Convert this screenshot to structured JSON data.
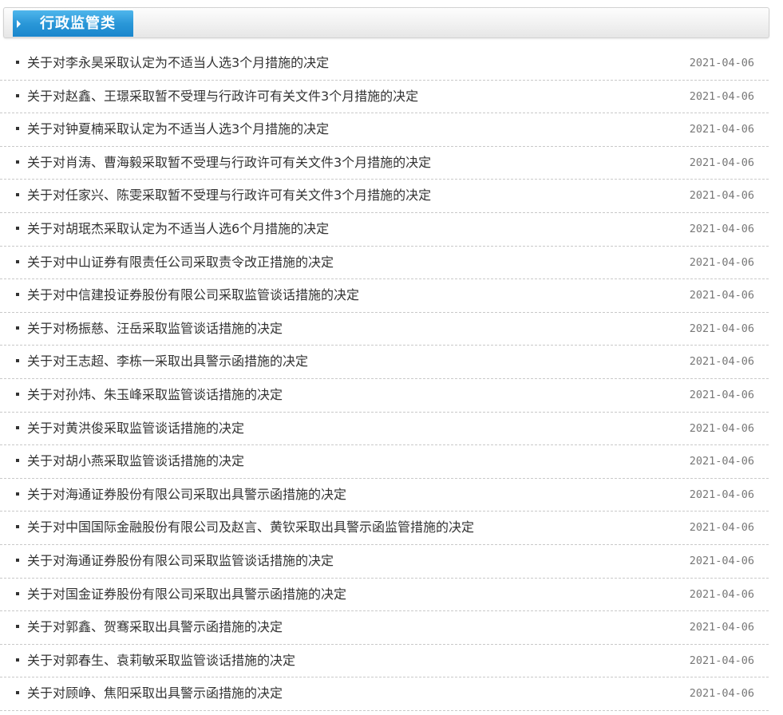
{
  "section": {
    "title": "行政监管类"
  },
  "items": [
    {
      "title": "关于对李永昊采取认定为不适当人选3个月措施的决定",
      "date": "2021-04-06"
    },
    {
      "title": "关于对赵鑫、王璟采取暂不受理与行政许可有关文件3个月措施的决定",
      "date": "2021-04-06"
    },
    {
      "title": "关于对钟夏楠采取认定为不适当人选3个月措施的决定",
      "date": "2021-04-06"
    },
    {
      "title": "关于对肖涛、曹海毅采取暂不受理与行政许可有关文件3个月措施的决定",
      "date": "2021-04-06"
    },
    {
      "title": "关于对任家兴、陈雯采取暂不受理与行政许可有关文件3个月措施的决定",
      "date": "2021-04-06"
    },
    {
      "title": "关于对胡珉杰采取认定为不适当人选6个月措施的决定",
      "date": "2021-04-06"
    },
    {
      "title": "关于对中山证券有限责任公司采取责令改正措施的决定",
      "date": "2021-04-06"
    },
    {
      "title": "关于对中信建投证券股份有限公司采取监管谈话措施的决定",
      "date": "2021-04-06"
    },
    {
      "title": "关于对杨振慈、汪岳采取监管谈话措施的决定",
      "date": "2021-04-06"
    },
    {
      "title": "关于对王志超、李栋一采取出具警示函措施的决定",
      "date": "2021-04-06"
    },
    {
      "title": "关于对孙炜、朱玉峰采取监管谈话措施的决定",
      "date": "2021-04-06"
    },
    {
      "title": "关于对黄洪俊采取监管谈话措施的决定",
      "date": "2021-04-06"
    },
    {
      "title": "关于对胡小燕采取监管谈话措施的决定",
      "date": "2021-04-06"
    },
    {
      "title": "关于对海通证券股份有限公司采取出具警示函措施的决定",
      "date": "2021-04-06"
    },
    {
      "title": "关于对中国国际金融股份有限公司及赵言、黄钦采取出具警示函监管措施的决定",
      "date": "2021-04-06"
    },
    {
      "title": "关于对海通证券股份有限公司采取监管谈话措施的决定",
      "date": "2021-04-06"
    },
    {
      "title": "关于对国金证券股份有限公司采取出具警示函措施的决定",
      "date": "2021-04-06"
    },
    {
      "title": "关于对郭鑫、贺骞采取出具警示函措施的决定",
      "date": "2021-04-06"
    },
    {
      "title": "关于对郭春生、袁莉敏采取监管谈话措施的决定",
      "date": "2021-04-06"
    },
    {
      "title": "关于对顾峥、焦阳采取出具警示函措施的决定",
      "date": "2021-04-06"
    }
  ]
}
